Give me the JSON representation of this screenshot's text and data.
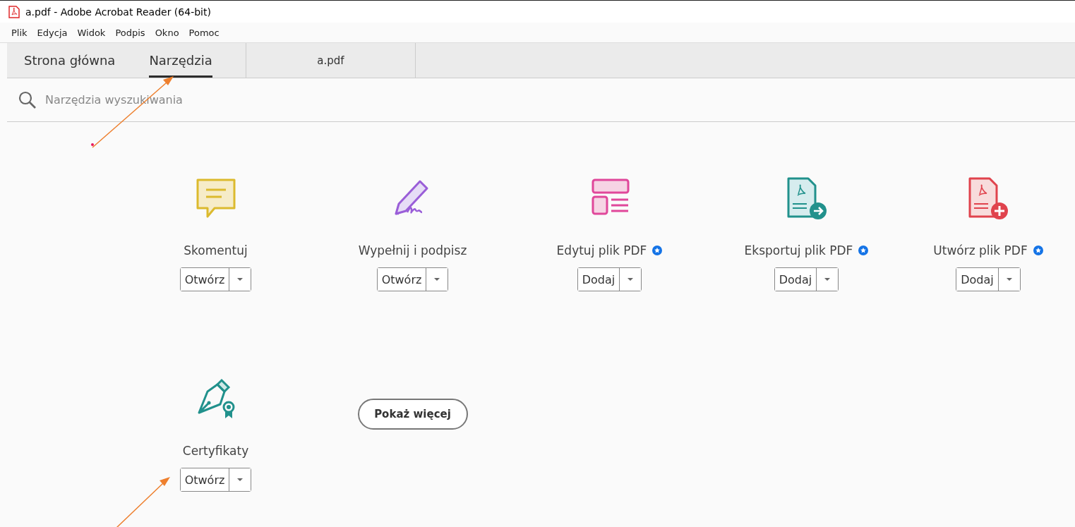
{
  "window": {
    "title": "a.pdf - Adobe Acrobat Reader (64-bit)"
  },
  "menu": [
    "Plik",
    "Edycja",
    "Widok",
    "Podpis",
    "Okno",
    "Pomoc"
  ],
  "tabs": [
    {
      "label": "Strona główna",
      "selected": false
    },
    {
      "label": "Narzędzia",
      "selected": true
    }
  ],
  "document_tab": {
    "label": "a.pdf"
  },
  "search": {
    "placeholder": "Narzędzia wyszukiwania"
  },
  "tools": [
    {
      "kind": "comment",
      "name": "Skomentuj",
      "button": "Otwórz",
      "premium": false
    },
    {
      "kind": "sign",
      "name": "Wypełnij i podpisz",
      "button": "Otwórz",
      "premium": false
    },
    {
      "kind": "edit",
      "name": "Edytuj plik PDF",
      "button": "Dodaj",
      "premium": true
    },
    {
      "kind": "export",
      "name": "Eksportuj plik PDF",
      "button": "Dodaj",
      "premium": true
    },
    {
      "kind": "create",
      "name": "Utwórz plik PDF",
      "button": "Dodaj",
      "premium": true
    },
    {
      "kind": "cert",
      "name": "Certyfikaty",
      "button": "Otwórz",
      "premium": false
    }
  ],
  "show_more": "Pokaż więcej"
}
